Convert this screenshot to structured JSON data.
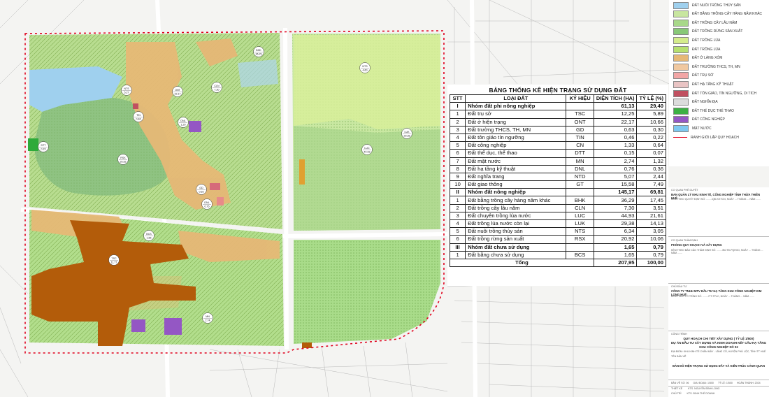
{
  "legend": {
    "items": [
      {
        "label": "ĐẤT NUÔI TRỒNG THỦY SẢN",
        "color": "#9fd0ee"
      },
      {
        "label": "ĐẤT BẰNG TRỒNG CÂY HÀNG NĂM KHÁC",
        "color": "#c8e6a0"
      },
      {
        "label": "ĐẤT TRỒNG CÂY LÂU NĂM",
        "color": "#a8d88a"
      },
      {
        "label": "ĐẤT TRỒNG RỪNG SẢN XUẤT",
        "color": "#88c878"
      },
      {
        "label": "ĐẤT TRỒNG LÚA",
        "color": "#d4ec8c"
      },
      {
        "label": "ĐẤT TRỒNG LÚA",
        "color": "#b6e070"
      },
      {
        "label": "ĐẤT Ở LÀNG XÓM",
        "color": "#e6b876"
      },
      {
        "label": "ĐẤT TRƯỜNG THCS, TH, MN",
        "color": "#f0c8a0"
      },
      {
        "label": "ĐẤT TRỤ SỞ",
        "color": "#f2a6a6"
      },
      {
        "label": "ĐẤT HẠ TẦNG KỸ THUẬT",
        "color": "#e9c4c4"
      },
      {
        "label": "ĐẤT TÔN GIÁO, TÍN NGƯỠNG, DI TÍCH",
        "color": "#c05060"
      },
      {
        "label": "ĐẤT NGHĨA ĐỊA",
        "color": "#dcdcdc"
      },
      {
        "label": "ĐẤT THỂ DỤC THỂ THAO",
        "color": "#3cb043"
      },
      {
        "label": "ĐẤT CÔNG NGHIỆP",
        "color": "#9457c4"
      },
      {
        "label": "MẶT NƯỚC",
        "color": "#7ec8f0"
      },
      {
        "label": "RANH GIỚI LẬP QUY HOẠCH",
        "color": "#e0001c"
      }
    ]
  },
  "stats": {
    "title": "BẢNG THỐNG KÊ HIỆN TRẠNG SỬ DỤNG ĐẤT",
    "headers": [
      "STT",
      "LOẠI ĐẤT",
      "KÝ HIỆU",
      "DIỆN TÍCH (HA)",
      "TỶ LỆ (%)"
    ],
    "rows": [
      {
        "stt": "I",
        "name": "Nhóm đất phi nông nghiệp",
        "code": "",
        "area": "61,13",
        "pct": "29,40",
        "group": true
      },
      {
        "stt": "1",
        "name": "Đất trụ sở",
        "code": "TSC",
        "area": "12,25",
        "pct": "5,89"
      },
      {
        "stt": "2",
        "name": "Đất ở hiện trạng",
        "code": "ONT",
        "area": "22,17",
        "pct": "10,66"
      },
      {
        "stt": "3",
        "name": "Đất trường THCS, TH, MN",
        "code": "GD",
        "area": "0,63",
        "pct": "0,30"
      },
      {
        "stt": "4",
        "name": "Đất tôn giáo tín ngưỡng",
        "code": "TIN",
        "area": "0,46",
        "pct": "0,22"
      },
      {
        "stt": "5",
        "name": "Đất công nghiệp",
        "code": "CN",
        "area": "1,33",
        "pct": "0,64"
      },
      {
        "stt": "6",
        "name": "Đất thể dục, thể thao",
        "code": "DTT",
        "area": "0,15",
        "pct": "0,07"
      },
      {
        "stt": "7",
        "name": "Đất mặt nước",
        "code": "MN",
        "area": "2,74",
        "pct": "1,32"
      },
      {
        "stt": "8",
        "name": "Đất hạ tầng kỹ thuật",
        "code": "DNL",
        "area": "0,76",
        "pct": "0,36"
      },
      {
        "stt": "9",
        "name": "Đất nghĩa trang",
        "code": "NTD",
        "area": "5,07",
        "pct": "2,44"
      },
      {
        "stt": "10",
        "name": "Đất giao thông",
        "code": "GT",
        "area": "15,58",
        "pct": "7,49"
      },
      {
        "stt": "II",
        "name": "Nhóm đất nông nghiệp",
        "code": "",
        "area": "145,17",
        "pct": "69,81",
        "group": true
      },
      {
        "stt": "1",
        "name": "Đất bằng trồng cây hàng năm khác",
        "code": "BHK",
        "area": "36,29",
        "pct": "17,45"
      },
      {
        "stt": "2",
        "name": "Đất trồng cây lâu năm",
        "code": "CLN",
        "area": "7,30",
        "pct": "3,51"
      },
      {
        "stt": "3",
        "name": "Đất chuyên trồng lúa nước",
        "code": "LUC",
        "area": "44,93",
        "pct": "21,61"
      },
      {
        "stt": "4",
        "name": "Đất trồng lúa nước còn lại",
        "code": "LUK",
        "area": "29,38",
        "pct": "14,13"
      },
      {
        "stt": "5",
        "name": "Đất nuôi trồng thủy sản",
        "code": "NTS",
        "area": "6,34",
        "pct": "3,05"
      },
      {
        "stt": "6",
        "name": "Đất trồng rừng sản xuất",
        "code": "RSX",
        "area": "20,92",
        "pct": "10,06"
      },
      {
        "stt": "III",
        "name": "Nhóm đất chưa sử dụng",
        "code": "",
        "area": "1,65",
        "pct": "0,79",
        "group": true
      },
      {
        "stt": "1",
        "name": "Đất bằng chưa sử dụng",
        "code": "BCS",
        "area": "1,65",
        "pct": "0,79"
      },
      {
        "stt": "",
        "name": "Tổng",
        "code": "",
        "area": "207,95",
        "pct": "100,00",
        "total": true
      }
    ]
  },
  "title_block": {
    "approve_agency_label": "CƠ QUAN PHÊ DUYỆT",
    "approve_agency": "BAN QUẢN LÝ KHU KINH TẾ, CÔNG NGHIỆP TỈNH THỪA THIÊN HUẾ",
    "approve_decision": "KÈM THEO QUYẾT ĐỊNH SỐ: ......../QĐ-KKTCN, NGÀY ... THÁNG ... NĂM .......",
    "appraise_agency_label": "CƠ QUAN THẨM ĐỊNH",
    "appraise_agency": "PHÒNG QUY HOẠCH VÀ XÂY DỰNG",
    "appraise_decision": "KÈM THEO BÁO CÁO THẨM ĐỊNH SỐ: ......../BCTĐ-PQHXD, NGÀY ... THÁNG ... NĂM .......",
    "investor_label": "CHỦ ĐẦU TƯ",
    "investor": "CÔNG TY TNHH MTV ĐẦU TƯ HẠ TẦNG KHU CÔNG NGHIỆP KIM LONG HUẾ",
    "investor_note": "KÈM THEO TỜ TRÌNH SỐ: ......../TT-TPLC, NGÀY ... THÁNG ... NĂM .......",
    "project_label": "CÔNG TRÌNH",
    "project_1": "QUY HOẠCH CHI TIẾT XÂY DỰNG ( TỶ LỆ 1/500)",
    "project_2": "DỰ ÁN ĐẦU TƯ XÂY DỰNG VÀ KINH DOANH KẾT CẤU HẠ TẦNG",
    "project_3": "KHU CÔNG NGHIỆP SỐ 02",
    "location": "ĐỊA ĐIỂM: KHU KINH TẾ CHÂN MÂY - LĂNG CÔ, HUYỆN PHÚ LỘC, TỈNH TT HUẾ",
    "drawing_label": "TÊN BẢN VẼ",
    "drawing_name": "BẢN ĐỒ HIỆN TRẠNG SỬ DỤNG ĐẤT VÀ KIẾN TRÚC CẢNH QUAN",
    "sheet_no": "BẢN VẼ SỐ: 06",
    "phase": "GIAI ĐOẠN: 1/500",
    "scale": "TỶ LỆ: 1/500",
    "date": "HOÀN THÀNH: 2024",
    "designer": "THIẾT KẾ",
    "designer_name": "KTS. NGUYỄN ĐÌNH LONG",
    "drafter": "CHỦ TRÌ",
    "drafter_name": "KTS. ĐINH THẾ DOANH"
  },
  "parcel_labels": [
    {
      "code": "BHK",
      "area": "36,29"
    },
    {
      "code": "NTS",
      "area": "4,60"
    },
    {
      "code": "NTS",
      "area": "5,27"
    },
    {
      "code": "ONT",
      "area": "22,17"
    },
    {
      "code": "CLN",
      "area": "7,30"
    },
    {
      "code": "TIN",
      "area": "0,46"
    },
    {
      "code": "DNL",
      "area": "1,20"
    },
    {
      "code": "DTT",
      "area": "0,15"
    },
    {
      "code": "RSX",
      "area": "20,92"
    },
    {
      "code": "GD",
      "area": "0,63"
    },
    {
      "code": "DNL",
      "area": "0,76"
    },
    {
      "code": "LUK",
      "area": "29,38"
    },
    {
      "code": "LUC",
      "area": "44,93"
    },
    {
      "code": "BCS",
      "area": "1,65"
    },
    {
      "code": "TSC",
      "area": "11,77"
    },
    {
      "code": "MN",
      "area": "2,74"
    }
  ]
}
